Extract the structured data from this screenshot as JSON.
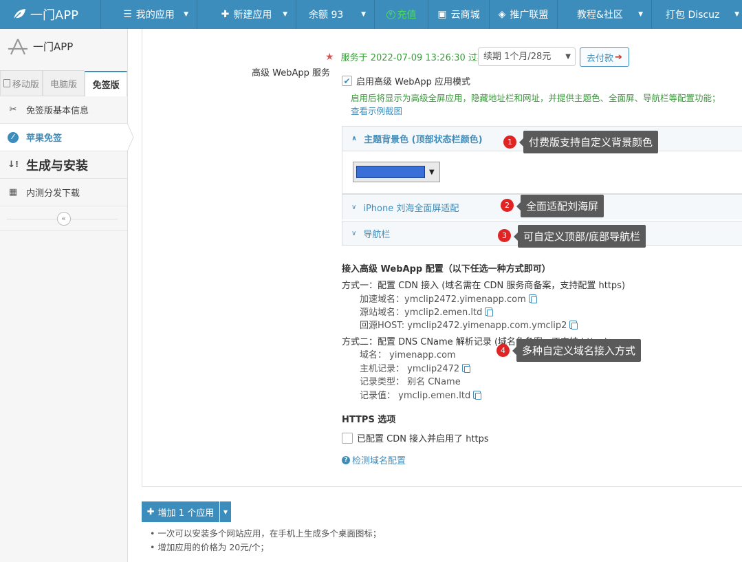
{
  "topnav": {
    "brand": "一门APP",
    "items": [
      {
        "label": "我的应用",
        "icon": "list-icon",
        "caret": true
      },
      {
        "label": "新建应用",
        "icon": "plus-icon",
        "caret": true
      },
      {
        "label": "余额 93",
        "icon": "",
        "caret": true
      },
      {
        "label": "充值",
        "icon": "yen-icon",
        "caret": false
      },
      {
        "label": "云商城",
        "icon": "shop-icon",
        "caret": false
      },
      {
        "label": "推广联盟",
        "icon": "diamond-icon",
        "caret": false
      },
      {
        "label": "教程&社区",
        "icon": "",
        "caret": true
      },
      {
        "label": "打包 Discuz",
        "icon": "",
        "caret": true
      }
    ]
  },
  "sidebar": {
    "logo_text": "一门APP",
    "tabs": [
      "移动版",
      "电脑版",
      "免签版"
    ],
    "menu": [
      {
        "label": "免签版基本信息",
        "icon": "scissors-icon"
      },
      {
        "label": "苹果免签",
        "icon": "compass-icon"
      },
      {
        "label": "生成与安装",
        "icon": "sort-icon"
      },
      {
        "label": "内测分发下载",
        "icon": "qrcode-icon"
      }
    ],
    "collapse_symbol": "«"
  },
  "service": {
    "label": "高级 WebApp 服务",
    "expire_text": "服务于 2022-07-09 13:26:30 过期",
    "renew_option": "续期 1个月/28元",
    "pay_button": "去付款",
    "enable_label": "启用高级 WebApp 应用模式",
    "enable_hint": "启用后将显示为高级全屏应用，隐藏地址栏和网址，并提供主题色、全面屏、导航栏等配置功能；",
    "example_link": "查看示例截图"
  },
  "accordions": [
    {
      "title": "主题背景色 (顶部状态栏颜色)",
      "expanded": true
    },
    {
      "title": "iPhone 刘海全面屏适配",
      "expanded": false
    },
    {
      "title": "导航栏",
      "expanded": false
    }
  ],
  "theme_color": "#3a6fd8",
  "tips": [
    {
      "num": "1",
      "text": "付费版支持自定义背景颜色"
    },
    {
      "num": "2",
      "text": "全面适配刘海屏"
    },
    {
      "num": "3",
      "text": "可自定义顶部/底部导航栏"
    },
    {
      "num": "4",
      "text": "多种自定义域名接入方式"
    }
  ],
  "config": {
    "title": "接入高级 WebApp 配置（以下任选一种方式即可）",
    "method1": "方式一：配置 CDN 接入 (域名需在 CDN 服务商备案，支持配置 https)",
    "m1_lines": [
      "加速域名：ymclip2472.yimenapp.com",
      "源站域名：ymclip2.emen.ltd",
      "回源HOST: ymclip2472.yimenapp.com.ymclip2"
    ],
    "method2": "方式二：配置 DNS CName 解析记录 (域名免备案，不支持 https)",
    "m2_lines": [
      "域名： yimenapp.com",
      "主机记录： ymclip2472",
      "记录类型： 别名 CName",
      "记录值： ymclip.emen.ltd"
    ]
  },
  "https": {
    "title": "HTTPS 选项",
    "checkbox_label": "已配置 CDN 接入并启用了 https",
    "detect_link": "检测域名配置"
  },
  "footer": {
    "add_button": "增加 1 个应用",
    "notes": [
      "• 一次可以安装多个网站应用，在手机上生成多个桌面图标；",
      "• 增加应用的价格为 20元/个；"
    ]
  }
}
